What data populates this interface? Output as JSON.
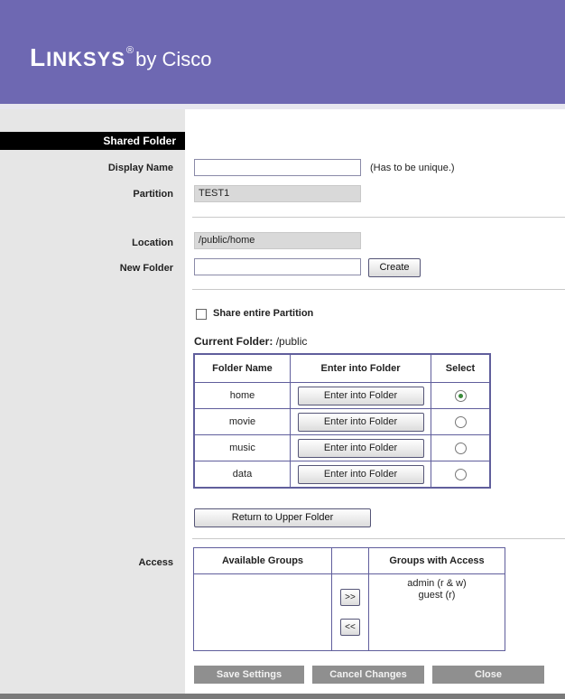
{
  "header": {
    "brand_first": "L",
    "brand_rest": "INKSYS",
    "reg_mark": "®",
    "by_text": "by Cisco",
    "background_color": "#6e68b2"
  },
  "section": {
    "title": "Shared Folder"
  },
  "form": {
    "display_name_label": "Display Name",
    "display_name_value": "",
    "display_name_hint": "(Has to be unique.)",
    "partition_label": "Partition",
    "partition_value": "TEST1",
    "location_label": "Location",
    "location_value": "/public/home",
    "new_folder_label": "New Folder",
    "new_folder_value": "",
    "create_button": "Create",
    "share_entire_label": "Share entire Partition",
    "share_entire_checked": false,
    "current_folder_label": "Current Folder:",
    "current_folder_value": "/public"
  },
  "folders_table": {
    "headers": [
      "Folder Name",
      "Enter into Folder",
      "Select"
    ],
    "rows": [
      {
        "name": "home",
        "button": "Enter into Folder",
        "selected": true
      },
      {
        "name": "movie",
        "button": "Enter into Folder",
        "selected": false
      },
      {
        "name": "music",
        "button": "Enter into Folder",
        "selected": false
      },
      {
        "name": "data",
        "button": "Enter into Folder",
        "selected": false
      }
    ]
  },
  "return_button": "Return to Upper Folder",
  "access": {
    "label": "Access",
    "available_header": "Available Groups",
    "with_access_header": "Groups with Access",
    "available_groups": [],
    "groups_with_access": [
      "admin (r & w)",
      "guest (r)"
    ],
    "add_button": ">>",
    "remove_button": "<<"
  },
  "footer": {
    "save": "Save Settings",
    "cancel": "Cancel Changes",
    "close": "Close"
  }
}
